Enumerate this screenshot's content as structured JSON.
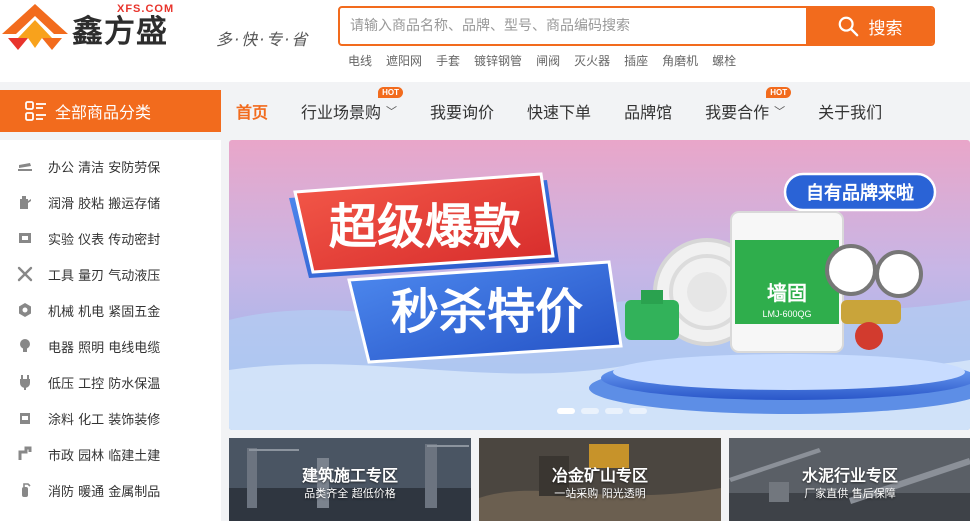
{
  "logo": {
    "name": "鑫方盛",
    "domain": "XFS.COM",
    "slogan": "多·快·专·省"
  },
  "search": {
    "placeholder": "请输入商品名称、品牌、型号、商品编码搜索",
    "button": "搜索"
  },
  "hot_words": [
    "电线",
    "遮阳网",
    "手套",
    "镀锌钢管",
    "闸阀",
    "灭火器",
    "插座",
    "角磨机",
    "螺栓"
  ],
  "nav": {
    "all_categories": "全部商品分类",
    "items": [
      {
        "label": "首页",
        "active": true
      },
      {
        "label": "行业场景购",
        "dropdown": true,
        "badge": "HOT"
      },
      {
        "label": "我要询价"
      },
      {
        "label": "快速下单"
      },
      {
        "label": "品牌馆"
      },
      {
        "label": "我要合作",
        "dropdown": true,
        "badge": "HOT"
      },
      {
        "label": "关于我们"
      }
    ]
  },
  "sidebar": {
    "items": [
      {
        "label": "办公 清洁 安防劳保",
        "icon": "stapler-icon"
      },
      {
        "label": "润滑 胶粘 搬运存储",
        "icon": "oil-can-icon"
      },
      {
        "label": "实验 仪表 传动密封",
        "icon": "instrument-icon"
      },
      {
        "label": "工具 量刃 气动液压",
        "icon": "tools-icon"
      },
      {
        "label": "机械 机电 紧固五金",
        "icon": "hex-nut-icon"
      },
      {
        "label": "电器 照明 电线电缆",
        "icon": "bulb-icon"
      },
      {
        "label": "低压 工控 防水保温",
        "icon": "plug-icon"
      },
      {
        "label": "涂料 化工 装饰装修",
        "icon": "paint-bucket-icon"
      },
      {
        "label": "市政 园林 临建土建",
        "icon": "pipe-icon"
      },
      {
        "label": "消防 暖通 金属制品",
        "icon": "extinguisher-icon"
      }
    ]
  },
  "banner": {
    "line1": "超级爆款",
    "line2": "秒杀特价",
    "tag": "自有品牌来啦",
    "product_brand": "墙固",
    "product_model": "LMJ-600QG",
    "slides": 4,
    "active_slide": 1
  },
  "zones": [
    {
      "title": "建筑施工专区",
      "subtitle": "品类齐全 超低价格"
    },
    {
      "title": "冶金矿山专区",
      "subtitle": "一站采购 阳光透明"
    },
    {
      "title": "水泥行业专区",
      "subtitle": "厂家直供 售后保障"
    }
  ],
  "colors": {
    "accent": "#f26b1d",
    "banner_red": "#e8342c",
    "banner_blue": "#2a63d6"
  }
}
